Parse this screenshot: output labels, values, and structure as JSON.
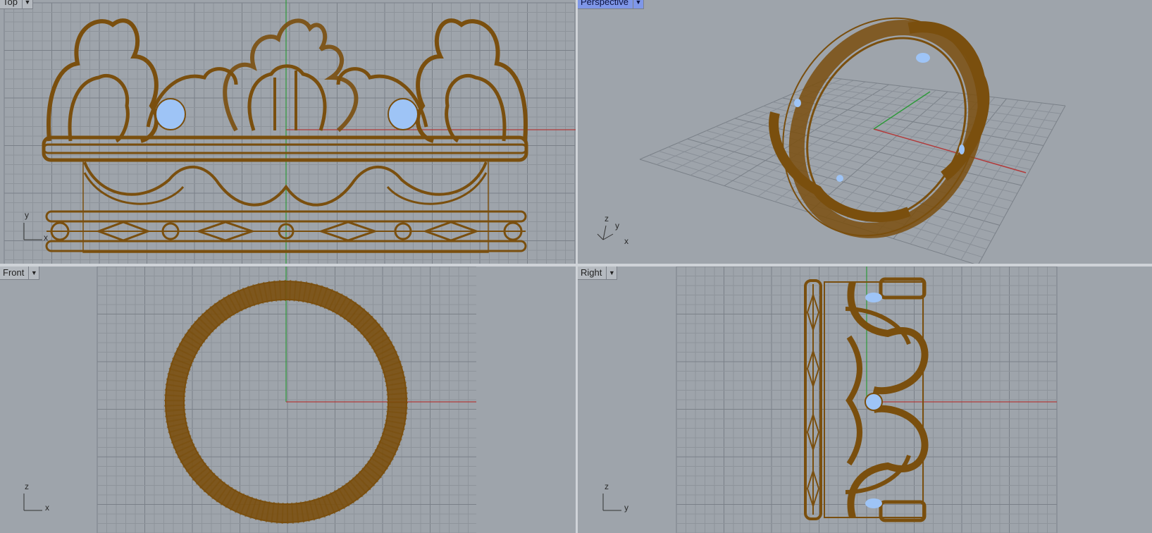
{
  "colors": {
    "viewport_bg": "#9ea4ab",
    "grid_minor": "#8e949b",
    "grid_major": "#7a8088",
    "model_wire": "#7a4f0e",
    "gem": "#9ec4f6",
    "x_axis": "#b23a3a",
    "y_axis": "#2e9a3a",
    "active_label_bg": "#7f97e8"
  },
  "viewports": {
    "top": {
      "label": "Top",
      "dropdown": "chevron-down-icon",
      "axis_a": "x",
      "axis_b": "y"
    },
    "perspective": {
      "label": "Perspective",
      "dropdown": "chevron-down-icon",
      "active": true,
      "axis_a": "x",
      "axis_b": "y",
      "axis_c": "z"
    },
    "front": {
      "label": "Front",
      "dropdown": "chevron-down-icon",
      "axis_a": "x",
      "axis_b": "z"
    },
    "right": {
      "label": "Right",
      "dropdown": "chevron-down-icon",
      "axis_a": "y",
      "axis_b": "z"
    }
  }
}
